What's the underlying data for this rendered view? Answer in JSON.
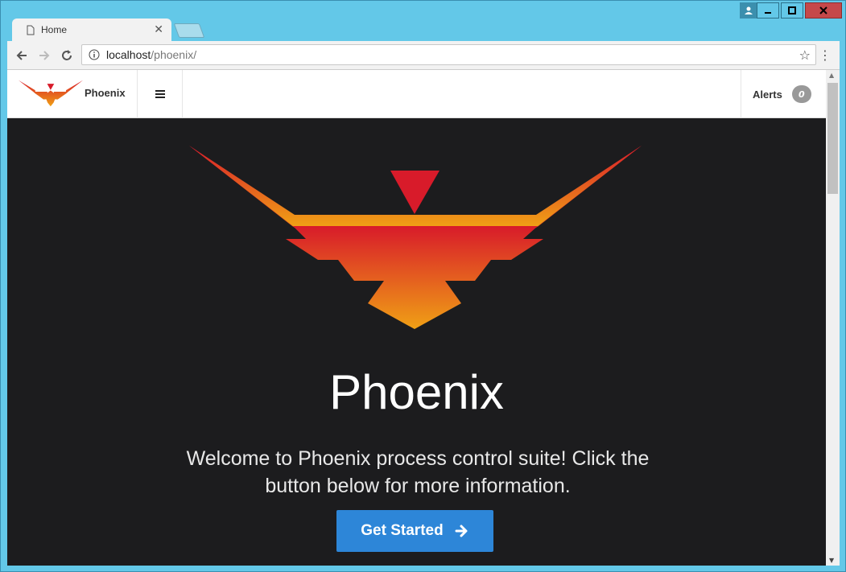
{
  "browser": {
    "tab_title": "Home",
    "tab_close": "✕",
    "url_host": "localhost",
    "url_path": "/phoenix/"
  },
  "app": {
    "brand": "Phoenix",
    "alerts_label": "Alerts",
    "alerts_count": "0"
  },
  "hero": {
    "title": "Phoenix",
    "text": "Welcome to Phoenix process control suite! Click the button below for more information.",
    "button_label": "Get Started"
  },
  "colors": {
    "logo_top": "#d81b2a",
    "logo_bottom": "#f0a015",
    "button": "#2d86d8",
    "hero_bg": "#1c1c1e"
  }
}
